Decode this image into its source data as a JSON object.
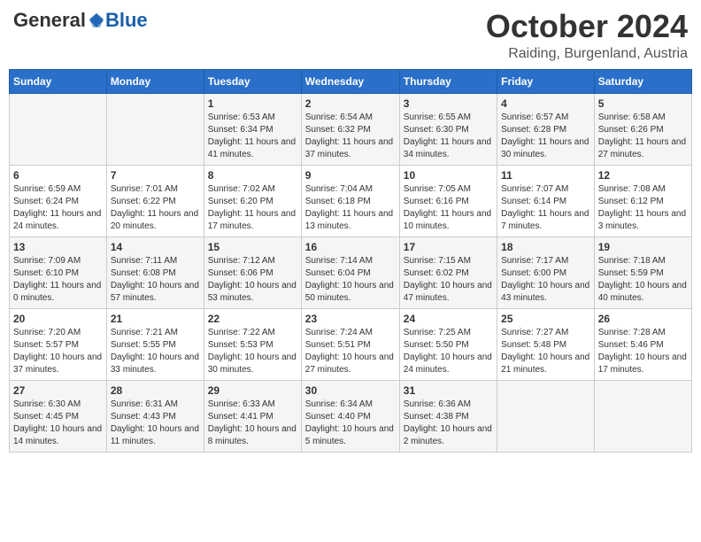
{
  "header": {
    "logo_general": "General",
    "logo_blue": "Blue",
    "month_title": "October 2024",
    "location": "Raiding, Burgenland, Austria"
  },
  "days_of_week": [
    "Sunday",
    "Monday",
    "Tuesday",
    "Wednesday",
    "Thursday",
    "Friday",
    "Saturday"
  ],
  "weeks": [
    [
      {
        "day": "",
        "info": ""
      },
      {
        "day": "",
        "info": ""
      },
      {
        "day": "1",
        "info": "Sunrise: 6:53 AM\nSunset: 6:34 PM\nDaylight: 11 hours and 41 minutes."
      },
      {
        "day": "2",
        "info": "Sunrise: 6:54 AM\nSunset: 6:32 PM\nDaylight: 11 hours and 37 minutes."
      },
      {
        "day": "3",
        "info": "Sunrise: 6:55 AM\nSunset: 6:30 PM\nDaylight: 11 hours and 34 minutes."
      },
      {
        "day": "4",
        "info": "Sunrise: 6:57 AM\nSunset: 6:28 PM\nDaylight: 11 hours and 30 minutes."
      },
      {
        "day": "5",
        "info": "Sunrise: 6:58 AM\nSunset: 6:26 PM\nDaylight: 11 hours and 27 minutes."
      }
    ],
    [
      {
        "day": "6",
        "info": "Sunrise: 6:59 AM\nSunset: 6:24 PM\nDaylight: 11 hours and 24 minutes."
      },
      {
        "day": "7",
        "info": "Sunrise: 7:01 AM\nSunset: 6:22 PM\nDaylight: 11 hours and 20 minutes."
      },
      {
        "day": "8",
        "info": "Sunrise: 7:02 AM\nSunset: 6:20 PM\nDaylight: 11 hours and 17 minutes."
      },
      {
        "day": "9",
        "info": "Sunrise: 7:04 AM\nSunset: 6:18 PM\nDaylight: 11 hours and 13 minutes."
      },
      {
        "day": "10",
        "info": "Sunrise: 7:05 AM\nSunset: 6:16 PM\nDaylight: 11 hours and 10 minutes."
      },
      {
        "day": "11",
        "info": "Sunrise: 7:07 AM\nSunset: 6:14 PM\nDaylight: 11 hours and 7 minutes."
      },
      {
        "day": "12",
        "info": "Sunrise: 7:08 AM\nSunset: 6:12 PM\nDaylight: 11 hours and 3 minutes."
      }
    ],
    [
      {
        "day": "13",
        "info": "Sunrise: 7:09 AM\nSunset: 6:10 PM\nDaylight: 11 hours and 0 minutes."
      },
      {
        "day": "14",
        "info": "Sunrise: 7:11 AM\nSunset: 6:08 PM\nDaylight: 10 hours and 57 minutes."
      },
      {
        "day": "15",
        "info": "Sunrise: 7:12 AM\nSunset: 6:06 PM\nDaylight: 10 hours and 53 minutes."
      },
      {
        "day": "16",
        "info": "Sunrise: 7:14 AM\nSunset: 6:04 PM\nDaylight: 10 hours and 50 minutes."
      },
      {
        "day": "17",
        "info": "Sunrise: 7:15 AM\nSunset: 6:02 PM\nDaylight: 10 hours and 47 minutes."
      },
      {
        "day": "18",
        "info": "Sunrise: 7:17 AM\nSunset: 6:00 PM\nDaylight: 10 hours and 43 minutes."
      },
      {
        "day": "19",
        "info": "Sunrise: 7:18 AM\nSunset: 5:59 PM\nDaylight: 10 hours and 40 minutes."
      }
    ],
    [
      {
        "day": "20",
        "info": "Sunrise: 7:20 AM\nSunset: 5:57 PM\nDaylight: 10 hours and 37 minutes."
      },
      {
        "day": "21",
        "info": "Sunrise: 7:21 AM\nSunset: 5:55 PM\nDaylight: 10 hours and 33 minutes."
      },
      {
        "day": "22",
        "info": "Sunrise: 7:22 AM\nSunset: 5:53 PM\nDaylight: 10 hours and 30 minutes."
      },
      {
        "day": "23",
        "info": "Sunrise: 7:24 AM\nSunset: 5:51 PM\nDaylight: 10 hours and 27 minutes."
      },
      {
        "day": "24",
        "info": "Sunrise: 7:25 AM\nSunset: 5:50 PM\nDaylight: 10 hours and 24 minutes."
      },
      {
        "day": "25",
        "info": "Sunrise: 7:27 AM\nSunset: 5:48 PM\nDaylight: 10 hours and 21 minutes."
      },
      {
        "day": "26",
        "info": "Sunrise: 7:28 AM\nSunset: 5:46 PM\nDaylight: 10 hours and 17 minutes."
      }
    ],
    [
      {
        "day": "27",
        "info": "Sunrise: 6:30 AM\nSunset: 4:45 PM\nDaylight: 10 hours and 14 minutes."
      },
      {
        "day": "28",
        "info": "Sunrise: 6:31 AM\nSunset: 4:43 PM\nDaylight: 10 hours and 11 minutes."
      },
      {
        "day": "29",
        "info": "Sunrise: 6:33 AM\nSunset: 4:41 PM\nDaylight: 10 hours and 8 minutes."
      },
      {
        "day": "30",
        "info": "Sunrise: 6:34 AM\nSunset: 4:40 PM\nDaylight: 10 hours and 5 minutes."
      },
      {
        "day": "31",
        "info": "Sunrise: 6:36 AM\nSunset: 4:38 PM\nDaylight: 10 hours and 2 minutes."
      },
      {
        "day": "",
        "info": ""
      },
      {
        "day": "",
        "info": ""
      }
    ]
  ]
}
